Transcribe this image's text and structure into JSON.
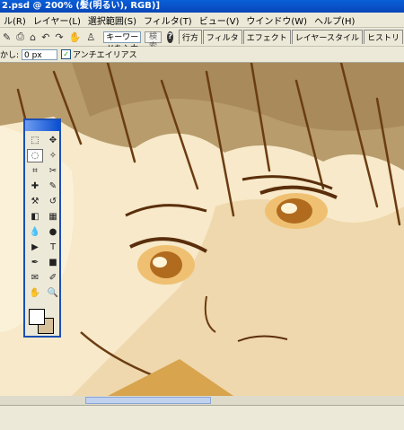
{
  "titlebar": {
    "title": "2.psd @ 200% (髪(明るい), RGB)]"
  },
  "menu": [
    "ル(R)",
    "レイヤー(L)",
    "選択範囲(S)",
    "フィルタ(T)",
    "ビュー(V)",
    "ウインドウ(W)",
    "ヘルプ(H)"
  ],
  "toolbar": {
    "icons": [
      "history-brush-icon",
      "print-icon",
      "save-icon",
      "undo-icon",
      "redo-icon",
      "hand-icon",
      "stamp-icon"
    ],
    "keyword_placeholder": "キーワードを入力",
    "search_label": "検索",
    "help_label": "?",
    "palette_tabs": [
      "行方",
      "フィルタ",
      "エフェクト",
      "レイヤースタイル",
      "ヒストリ"
    ]
  },
  "options": {
    "feather_label": "かし:",
    "feather_value": "0 px",
    "antialias_label": "アンチエイリアス"
  },
  "toolbox": {
    "tools": [
      "marquee-icon",
      "move-icon",
      "lasso-icon",
      "magic-wand-icon",
      "crop-icon",
      "slice-icon",
      "heal-icon",
      "brush-icon",
      "stamp-icon",
      "history-icon",
      "eraser-icon",
      "gradient-icon",
      "blur-icon",
      "dodge-icon",
      "path-icon",
      "text-icon",
      "pen-icon",
      "shape-icon",
      "notes-icon",
      "eyedropper-icon",
      "hand-icon",
      "zoom-icon"
    ],
    "glyphs": [
      "⬚",
      "✥",
      "◌",
      "✧",
      "⌗",
      "✂",
      "✚",
      "✎",
      "⚒",
      "↺",
      "◧",
      "▦",
      "💧",
      "●",
      "▶",
      "T",
      "✒",
      "■",
      "✉",
      "✐",
      "✋",
      "🔍"
    ],
    "fg_color": "#ffffff",
    "bg_color": "#d6c09a"
  }
}
